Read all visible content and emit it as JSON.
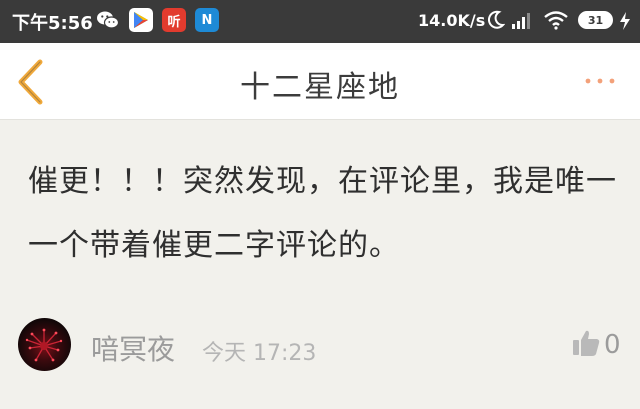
{
  "status_bar": {
    "time": "下午5:56",
    "network_speed": "14.0K/s",
    "battery_level": "31",
    "apps": [
      {
        "name": "wechat-icon",
        "glyph": "",
        "bg": "#3a3a3a"
      },
      {
        "name": "play-store-icon",
        "glyph": "▶",
        "bg": "#ffffff"
      },
      {
        "name": "ting-app-icon",
        "glyph": "听",
        "bg": "#e23b2e"
      },
      {
        "name": "n-app-icon",
        "glyph": "N",
        "bg": "#1e8ad6"
      }
    ]
  },
  "header": {
    "title": "十二星座地",
    "accent_color": "#f0a93b",
    "more_color": "#f3a17a"
  },
  "post": {
    "body": "催更！！！突然发现，在评论里，我是唯一一个带着催更二字评论的。"
  },
  "comment_meta": {
    "username": "喑冥夜",
    "timestamp": "今天 17:23",
    "like_count": "0"
  }
}
